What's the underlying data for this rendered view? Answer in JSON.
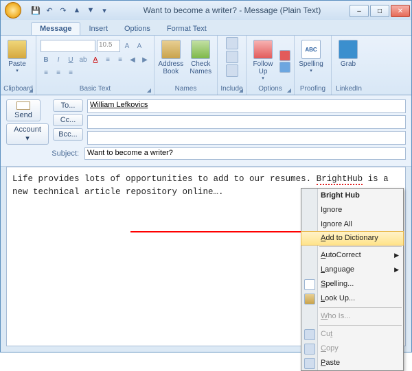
{
  "title": "Want to become a writer? - Message (Plain Text)",
  "qat_icons": [
    "save-icon",
    "undo-icon",
    "redo-icon",
    "prev-icon",
    "next-icon"
  ],
  "win": {
    "min": "–",
    "max": "□",
    "close": "✕"
  },
  "tabs": [
    "Message",
    "Insert",
    "Options",
    "Format Text"
  ],
  "active_tab": "Message",
  "ribbon": {
    "clipboard": {
      "label": "Clipboard",
      "paste": "Paste"
    },
    "basic_text": {
      "label": "Basic Text",
      "size": "10.5"
    },
    "names": {
      "label": "Names",
      "address": "Address Book",
      "check": "Check Names"
    },
    "include": {
      "label": "Include"
    },
    "options": {
      "label": "Options",
      "follow": "Follow Up"
    },
    "proofing": {
      "label": "Proofing",
      "spelling": "Spelling",
      "abc": "ABC"
    },
    "linkedin": {
      "label": "LinkedIn",
      "grab": "Grab"
    }
  },
  "fields": {
    "send": "Send",
    "to_btn": "To...",
    "cc_btn": "Cc...",
    "bcc_btn": "Bcc...",
    "account_btn": "Account ▾",
    "to_value": "William Lefkovics",
    "cc_value": "",
    "bcc_value": "",
    "subject_label": "Subject:",
    "subject_value": "Want to become a writer?"
  },
  "body": {
    "pre": "Life provides lots of opportunities to add to our resumes. ",
    "mis": "BrightHub",
    "post": " is a new technical article repository online…."
  },
  "context_menu": [
    {
      "label": "Bright Hub",
      "bold": true
    },
    {
      "label": "Ignore"
    },
    {
      "label": "Ignore All"
    },
    {
      "label": "Add to Dictionary",
      "hl": true,
      "u": "A"
    },
    {
      "sep": true
    },
    {
      "label": "AutoCorrect",
      "sub": true,
      "u": "A"
    },
    {
      "label": "Language",
      "sub": true,
      "u": "L"
    },
    {
      "label": "Spelling...",
      "icon": "abc",
      "u": "S"
    },
    {
      "label": "Look Up...",
      "icon": "book",
      "u": "L"
    },
    {
      "sep": true
    },
    {
      "label": "Who Is...",
      "dis": true,
      "u": "W"
    },
    {
      "sep": true
    },
    {
      "label": "Cut",
      "icon": "cut",
      "dis": true,
      "u": "t"
    },
    {
      "label": "Copy",
      "icon": "copy",
      "dis": true,
      "u": "C"
    },
    {
      "label": "Paste",
      "icon": "paste",
      "u": "P"
    }
  ]
}
